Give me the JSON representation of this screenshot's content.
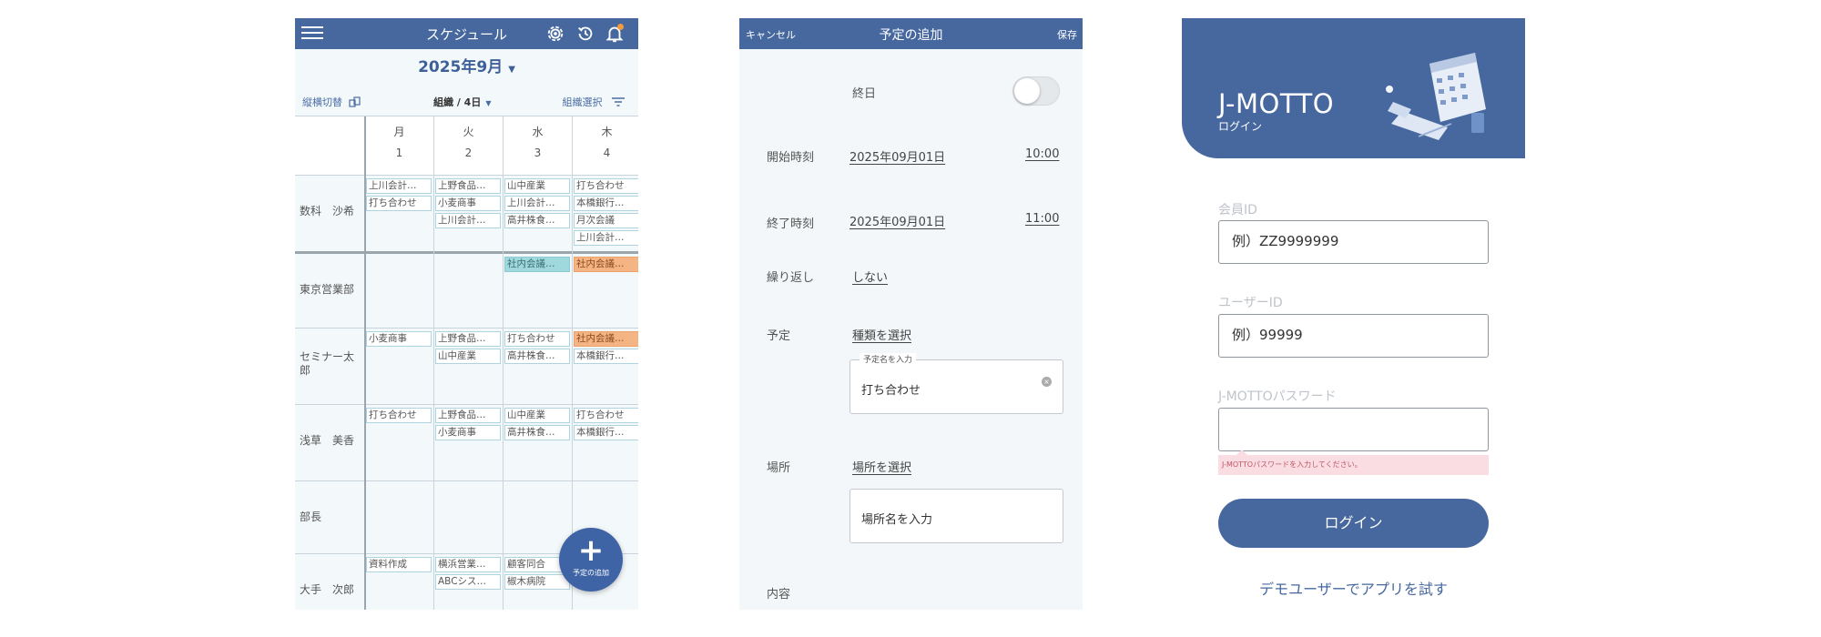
{
  "schedule": {
    "title": "スケジュール",
    "month": "2025年9月",
    "toolbar": {
      "left": "縦横切替",
      "middle": "組織 / 4日",
      "right": "組織選択"
    },
    "days": [
      {
        "name": "月",
        "num": "1"
      },
      {
        "name": "火",
        "num": "2"
      },
      {
        "name": "水",
        "num": "3"
      },
      {
        "name": "木",
        "num": "4"
      }
    ],
    "rows": [
      {
        "name": "数科　沙希"
      },
      {
        "name": "東京営業部"
      },
      {
        "name": "セミナー太郎"
      },
      {
        "name": "浅草　美香"
      },
      {
        "name": "部長"
      },
      {
        "name": "大手　次郎"
      }
    ],
    "events": {
      "r0": {
        "d0": [
          "上川会計…",
          "打ち合わせ"
        ],
        "d1": [
          "上野食品…",
          "小麦商事",
          "上川会計…"
        ],
        "d2": [
          "山中産業",
          "上川会計…",
          "高井株食…"
        ],
        "d3": [
          "打ち合わせ",
          "本橋銀行…",
          "月次会議",
          "上川会計…"
        ]
      },
      "r1": {
        "d2": [
          "社内会議…"
        ],
        "d3": [
          "社内会議…"
        ]
      },
      "r2": {
        "d0": [
          "小麦商事"
        ],
        "d1": [
          "上野食品…",
          "山中産業"
        ],
        "d2": [
          "打ち合わせ",
          "高井株食…"
        ],
        "d3": [
          "社内会議…",
          "本橋銀行…"
        ]
      },
      "r3": {
        "d0": [
          "打ち合わせ"
        ],
        "d1": [
          "上野食品…",
          "小麦商事"
        ],
        "d2": [
          "山中産業",
          "高井株食…"
        ],
        "d3": [
          "打ち合わせ",
          "本橋銀行…"
        ]
      },
      "r5": {
        "d0": [
          "資料作成"
        ],
        "d1": [
          "横浜営業…",
          "ABCシス…"
        ],
        "d2": [
          "顧客同合",
          "椒木病院"
        ]
      }
    },
    "fab_label": "予定の追加"
  },
  "add_event": {
    "cancel": "キャンセル",
    "title": "予定の追加",
    "save": "保存",
    "all_day_label": "終日",
    "start_label": "開始時刻",
    "start_date": "2025年09月01日",
    "start_time": "10:00",
    "end_label": "終了時刻",
    "end_date": "2025年09月01日",
    "end_time": "11:00",
    "repeat_label": "繰り返し",
    "repeat_value": "しない",
    "event_label": "予定",
    "event_type": "種類を選択",
    "event_name_legend": "予定名を入力",
    "event_name_value": "打ち合わせ",
    "place_label": "場所",
    "place_select": "場所を選択",
    "place_placeholder": "場所名を入力",
    "content_label": "内容"
  },
  "login": {
    "brand": "J-MOTTO",
    "subtitle": "ログイン",
    "member_id_label": "会員ID",
    "member_id_placeholder": "例）ZZ9999999",
    "user_id_label": "ユーザーID",
    "user_id_placeholder": "例）99999",
    "password_label": "J-MOTTOパスワード",
    "password_error": "J-MOTTOパスワードを入力してください。",
    "login_button": "ログイン",
    "demo_link": "デモユーザーでアプリを試す"
  },
  "colors": {
    "primary": "#46689f",
    "event_teal": "#9fd8dd",
    "event_orange": "#f4b484",
    "error_bg": "#f9dde2"
  }
}
